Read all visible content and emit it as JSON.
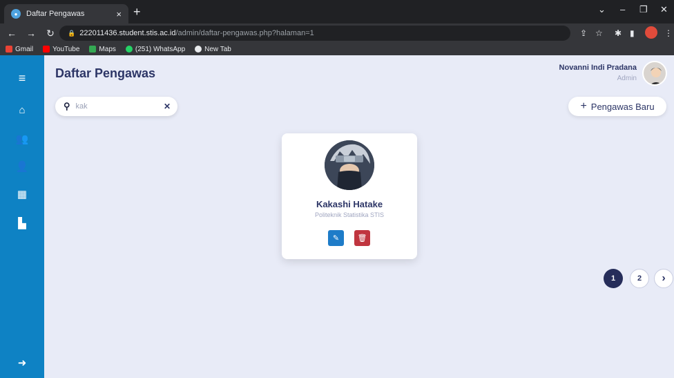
{
  "browser": {
    "tab_title": "Daftar Pengawas",
    "tab_close": "×",
    "new_tab": "+",
    "url_host": "222011436.student.stis.ac.id",
    "url_path": "/admin/daftar-pengawas.php?halaman=1",
    "bookmarks": [
      "Gmail",
      "YouTube",
      "Maps",
      "(251) WhatsApp",
      "New Tab"
    ]
  },
  "app": {
    "page_title": "Daftar Pengawas",
    "user": {
      "name": "Novanni Indi Pradana",
      "role": "Admin"
    },
    "search": {
      "value": "kak",
      "placeholder": ""
    },
    "add_button": "Pengawas Baru",
    "card": {
      "name": "Kakashi Hatake",
      "org": "Politeknik Statistika STIS"
    },
    "pagination": [
      "1",
      "2"
    ],
    "next": "›"
  },
  "colors": {
    "sidebar": "#0e82c4",
    "title": "#2c3566",
    "edit": "#1e7cc8",
    "delete": "#c0353f",
    "active_page": "#262d5a"
  }
}
